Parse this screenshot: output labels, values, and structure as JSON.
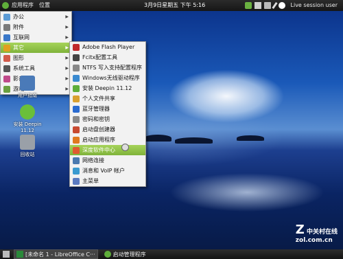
{
  "top_panel": {
    "applications": "应用程序",
    "places": "位置",
    "clock": "3月9日星期五 下午  5:16",
    "user": "Live session user"
  },
  "main_menu": [
    {
      "label": "办公",
      "icon": "office-icon",
      "color": "#5b9bd5",
      "submenu": true
    },
    {
      "label": "附件",
      "icon": "accessories-icon",
      "color": "#7a7a7a",
      "submenu": true
    },
    {
      "label": "互联网",
      "icon": "internet-icon",
      "color": "#3a78c9",
      "submenu": true
    },
    {
      "label": "其它",
      "icon": "other-icon",
      "color": "#e0a020",
      "submenu": true,
      "highlighted": true
    },
    {
      "label": "图形",
      "icon": "graphics-icon",
      "color": "#d25a4a",
      "submenu": true
    },
    {
      "label": "系统工具",
      "icon": "system-tools-icon",
      "color": "#555555",
      "submenu": true
    },
    {
      "label": "影音",
      "icon": "media-icon",
      "color": "#c04a8a",
      "submenu": true
    },
    {
      "label": "游戏",
      "icon": "games-icon",
      "color": "#6aa040",
      "submenu": true
    }
  ],
  "sub_menu": [
    {
      "label": "Adobe Flash Player",
      "icon": "flash-icon",
      "color": "#c0282a"
    },
    {
      "label": "Fcitx配置工具",
      "icon": "keyboard-icon",
      "color": "#444444"
    },
    {
      "label": "NTFS 写入支持配置程序",
      "icon": "drive-icon",
      "color": "#888888"
    },
    {
      "label": "Windows无线驱动程序",
      "icon": "wireless-icon",
      "color": "#3a8ad0"
    },
    {
      "label": "安装 Deepin 11.12",
      "icon": "deepin-install-icon",
      "color": "#5fae3a"
    },
    {
      "label": "个人文件共享",
      "icon": "share-icon",
      "color": "#d9a030"
    },
    {
      "label": "蓝牙管理器",
      "icon": "bluetooth-icon",
      "color": "#2a6bd0"
    },
    {
      "label": "密码和密钥",
      "icon": "key-icon",
      "color": "#8a8a8a"
    },
    {
      "label": "启动盘创建器",
      "icon": "usb-icon",
      "color": "#c84a30"
    },
    {
      "label": "启动应用程序",
      "icon": "startup-icon",
      "color": "#e07a20"
    },
    {
      "label": "深度软件中心",
      "icon": "software-center-icon",
      "color": "#e05a30",
      "highlighted": true
    },
    {
      "label": "网络连接",
      "icon": "network-icon",
      "color": "#4a7ab0"
    },
    {
      "label": "消息和 VoIP 帐户",
      "icon": "im-icon",
      "color": "#3a9ad0"
    },
    {
      "label": "主菜单",
      "icon": "menu-icon",
      "color": "#5a7ac0"
    }
  ],
  "desktop_icons": [
    {
      "label": "用户指南",
      "icon": "user-guide-icon",
      "color": "#4a7ab8"
    },
    {
      "label": "安装 Deepin 11.12",
      "icon": "deepin-install-icon",
      "color": "#6abf3a"
    },
    {
      "label": "回收站",
      "icon": "trash-icon",
      "color": "#9aa0a8"
    }
  ],
  "taskbar": [
    {
      "label": "[未命名 1 - LibreOffice C···",
      "icon": "libreoffice-icon",
      "color": "#2a8a3a"
    },
    {
      "label": "启动管理程序",
      "icon": "launcher-icon",
      "color": "#5fae3a"
    }
  ],
  "watermark": {
    "brand": "中关村在线",
    "url": "zol.com.cn",
    "letter": "Z"
  }
}
